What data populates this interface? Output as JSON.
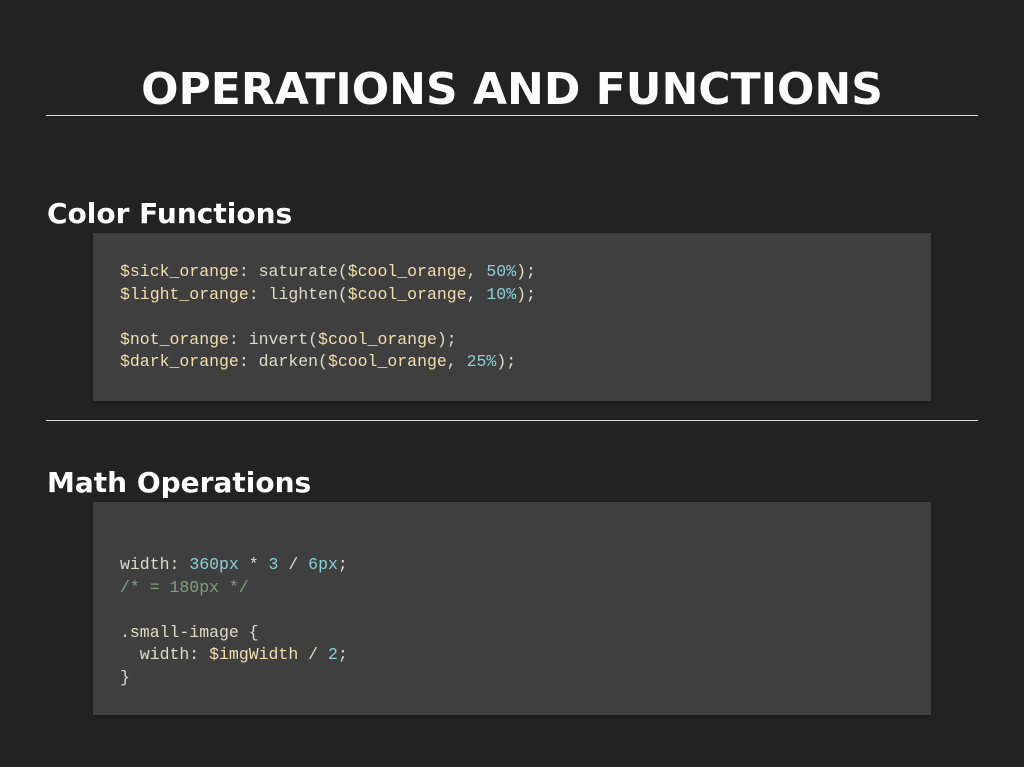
{
  "slide": {
    "title": "OPERATIONS AND FUNCTIONS"
  },
  "sections": [
    {
      "heading": "Color Functions",
      "code_lines": [
        [
          {
            "type": "var",
            "text": "$sick_orange"
          },
          {
            "type": "plain",
            "text": ": saturate("
          },
          {
            "type": "var",
            "text": "$cool_orange"
          },
          {
            "type": "plain",
            "text": ", "
          },
          {
            "type": "num",
            "text": "50%"
          },
          {
            "type": "plain",
            "text": ");"
          }
        ],
        [
          {
            "type": "var",
            "text": "$light_orange"
          },
          {
            "type": "plain",
            "text": ": lighten("
          },
          {
            "type": "var",
            "text": "$cool_orange"
          },
          {
            "type": "plain",
            "text": ", "
          },
          {
            "type": "num",
            "text": "10%"
          },
          {
            "type": "plain",
            "text": ");"
          }
        ],
        [],
        [
          {
            "type": "var",
            "text": "$not_orange"
          },
          {
            "type": "plain",
            "text": ": invert("
          },
          {
            "type": "var",
            "text": "$cool_orange"
          },
          {
            "type": "plain",
            "text": ");"
          }
        ],
        [
          {
            "type": "var",
            "text": "$dark_orange"
          },
          {
            "type": "plain",
            "text": ": darken("
          },
          {
            "type": "var",
            "text": "$cool_orange"
          },
          {
            "type": "plain",
            "text": ", "
          },
          {
            "type": "num",
            "text": "25%"
          },
          {
            "type": "plain",
            "text": ");"
          }
        ]
      ]
    },
    {
      "heading": "Math Operations",
      "code_lines": [
        [
          {
            "type": "plain",
            "text": "width: "
          },
          {
            "type": "num",
            "text": "360px"
          },
          {
            "type": "plain",
            "text": " * "
          },
          {
            "type": "num",
            "text": "3"
          },
          {
            "type": "plain",
            "text": " / "
          },
          {
            "type": "num",
            "text": "6px"
          },
          {
            "type": "plain",
            "text": ";"
          }
        ],
        [
          {
            "type": "comment",
            "text": "/* = 180px */"
          }
        ],
        [],
        [
          {
            "type": "plain",
            "text": ".small-image {"
          }
        ],
        [
          {
            "type": "plain",
            "text": "  width: "
          },
          {
            "type": "var",
            "text": "$imgWidth"
          },
          {
            "type": "plain",
            "text": " / "
          },
          {
            "type": "num",
            "text": "2"
          },
          {
            "type": "plain",
            "text": ";"
          }
        ],
        [
          {
            "type": "plain",
            "text": "}"
          }
        ]
      ]
    }
  ],
  "colors": {
    "background": "#222222",
    "code_background": "#3f3f3f",
    "rule": "#d8d8d8",
    "token_var": "#f0dfaf",
    "token_plain": "#dcdccc",
    "token_number": "#8cd0d3",
    "token_comment": "#7f9f7f"
  }
}
